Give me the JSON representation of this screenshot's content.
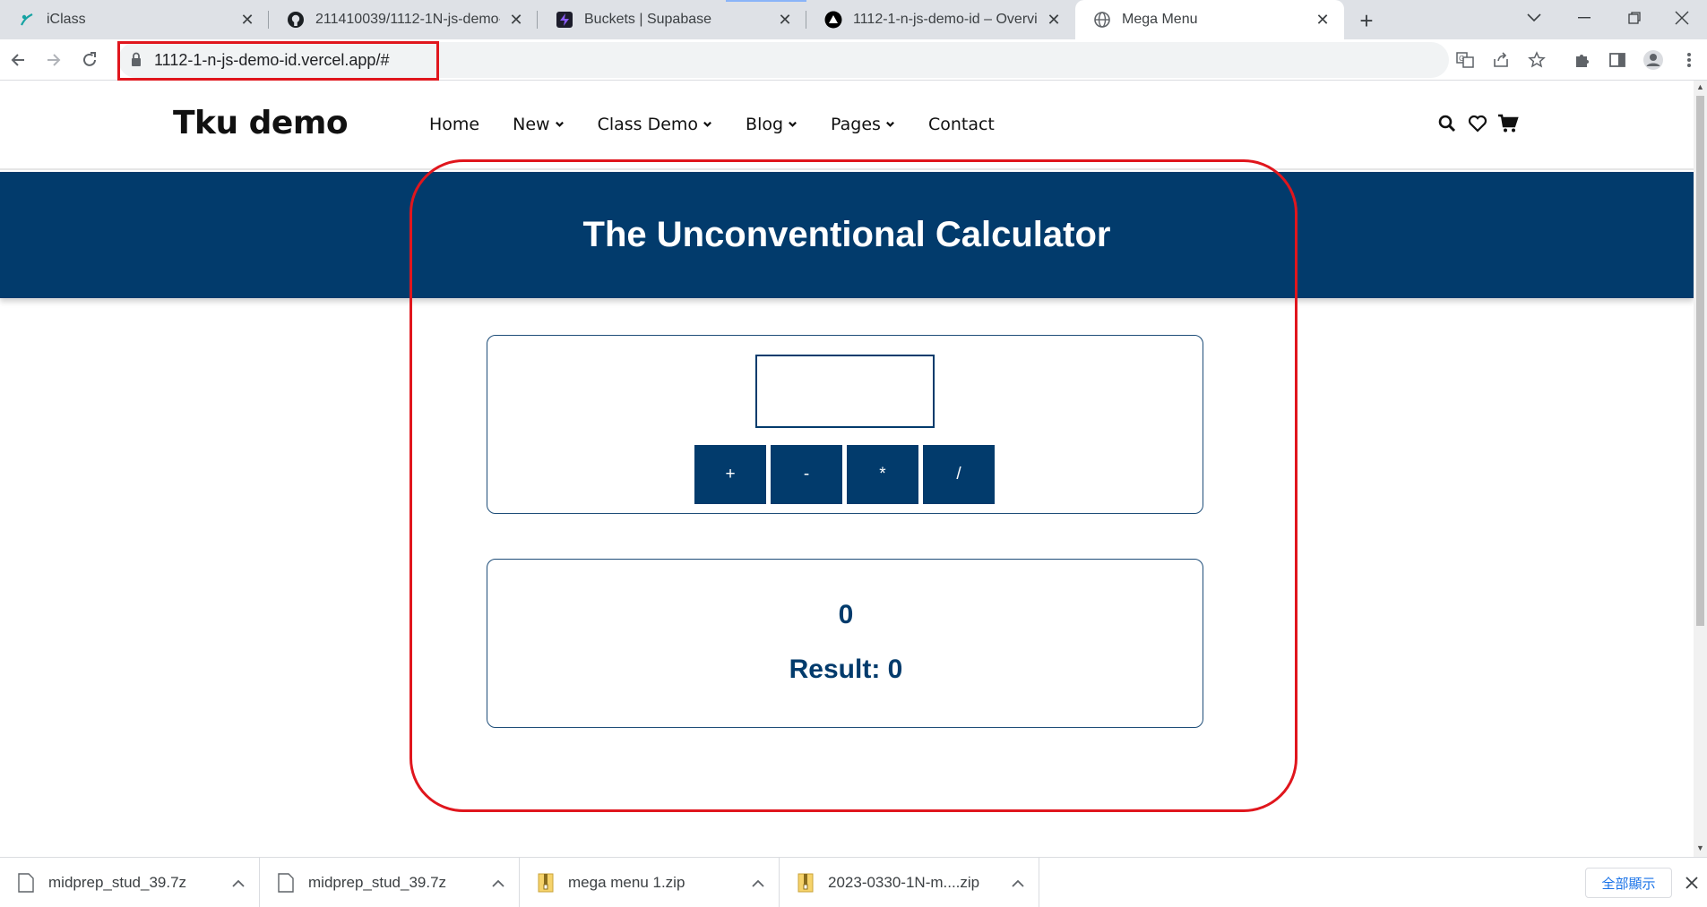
{
  "browser": {
    "tabs": [
      {
        "title": "iClass",
        "icon": "iclass-icon"
      },
      {
        "title": "211410039/1112-1N-js-demo-",
        "icon": "github-icon"
      },
      {
        "title": "Buckets | Supabase",
        "icon": "supabase-icon"
      },
      {
        "title": "1112-1-n-js-demo-id – Overvie",
        "icon": "vercel-icon"
      },
      {
        "title": "Mega Menu",
        "icon": "globe-icon",
        "active": true
      }
    ],
    "new_tab_label": "+",
    "url": "1112-1-n-js-demo-id.vercel.app/#"
  },
  "site": {
    "logo": "Tku demo",
    "nav": [
      {
        "label": "Home",
        "dropdown": false
      },
      {
        "label": "New",
        "dropdown": true
      },
      {
        "label": "Class Demo",
        "dropdown": true
      },
      {
        "label": "Blog",
        "dropdown": true
      },
      {
        "label": "Pages",
        "dropdown": true
      },
      {
        "label": "Contact",
        "dropdown": false
      }
    ],
    "header_icons": [
      "search-icon",
      "heart-icon",
      "cart-icon"
    ]
  },
  "calculator": {
    "title": "The Unconventional Calculator",
    "input_value": "",
    "operators": [
      "+",
      "-",
      "*",
      "/"
    ],
    "current_value": "0",
    "result_line": "Result: 0"
  },
  "downloads": {
    "items": [
      {
        "name": "midprep_stud_39.7z",
        "type": "file"
      },
      {
        "name": "midprep_stud_39.7z",
        "type": "file"
      },
      {
        "name": "mega menu 1.zip",
        "type": "zip"
      },
      {
        "name": "2023-0330-1N-m....zip",
        "type": "zip"
      }
    ],
    "show_all_label": "全部顯示"
  },
  "colors": {
    "brand_blue": "#023b6c",
    "annotation_red": "#e0161d",
    "link_blue": "#1a73e8"
  }
}
